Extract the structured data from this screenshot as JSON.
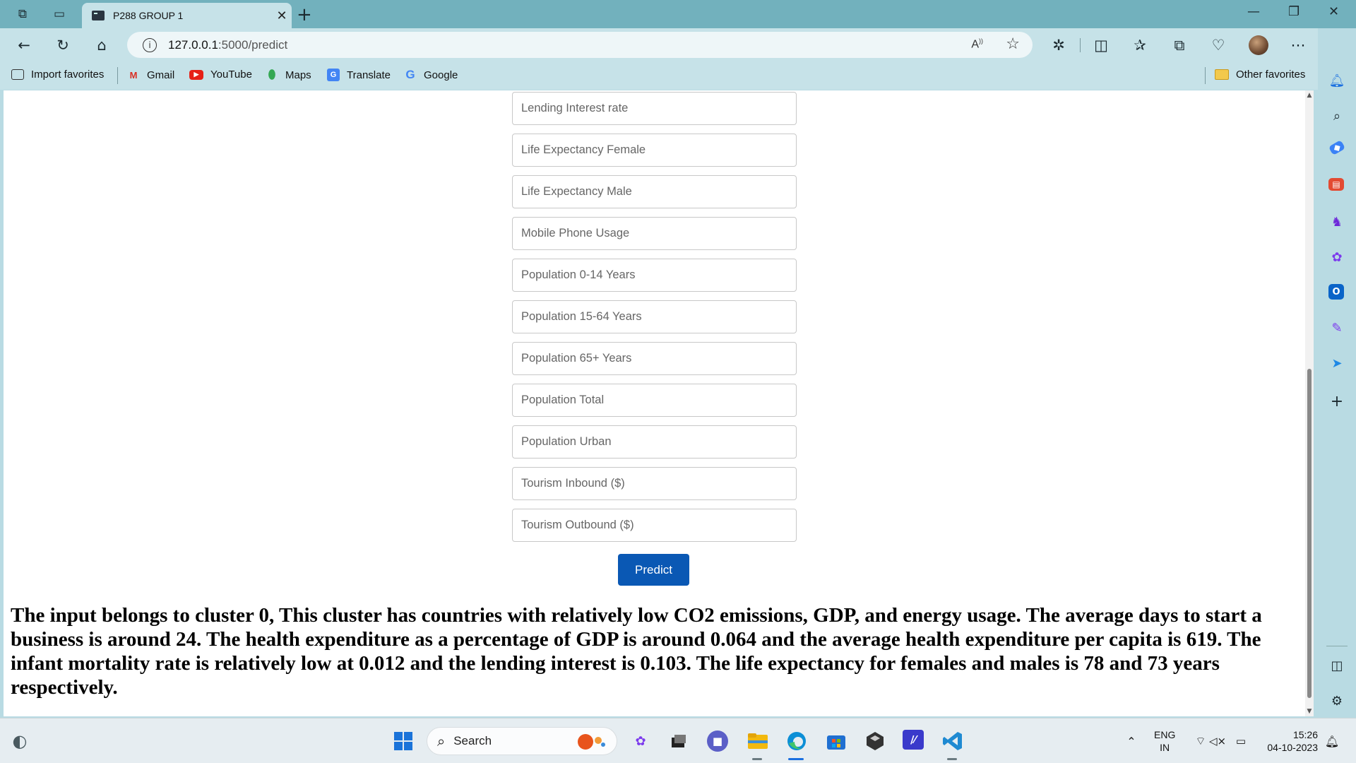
{
  "browser": {
    "tab_title": "P288 GROUP 1",
    "url_host": "127.0.0.1",
    "url_path": ":5000/predict",
    "read_aloud": "A)"
  },
  "favorites": [
    {
      "label": "Import favorites",
      "icon": "import-icon"
    },
    {
      "label": "Gmail",
      "icon": "gmail-icon"
    },
    {
      "label": "YouTube",
      "icon": "youtube-icon"
    },
    {
      "label": "Maps",
      "icon": "maps-icon"
    },
    {
      "label": "Translate",
      "icon": "translate-icon"
    },
    {
      "label": "Google",
      "icon": "google-icon"
    }
  ],
  "other_favorites": "Other favorites",
  "form": {
    "fields": [
      "Lending Interest rate",
      "Life Expectancy Female",
      "Life Expectancy Male",
      "Mobile Phone Usage",
      "Population 0-14 Years",
      "Population 15-64 Years",
      "Population 65+ Years",
      "Population Total",
      "Population Urban",
      "Tourism Inbound ($)",
      "Tourism Outbound ($)"
    ],
    "submit_label": "Predict"
  },
  "result_text": "The input belongs to cluster 0, This cluster has countries with relatively low CO2 emissions, GDP, and energy usage. The average days to start a business is around 24. The health expenditure as a percentage of GDP is around 0.064 and the average health expenditure per capita is 619. The infant mortality rate is relatively low at 0.012 and the lending interest is 0.103. The life expectancy for females and males is 78 and 73 years respectively.",
  "taskbar": {
    "search_label": "Search",
    "lang_top": "ENG",
    "lang_bottom": "IN",
    "time": "15:26",
    "date": "04-10-2023"
  },
  "colors": {
    "accent": "#0a58b4",
    "tabbar": "#72b1bd",
    "toolbar": "#c6e2e8"
  }
}
